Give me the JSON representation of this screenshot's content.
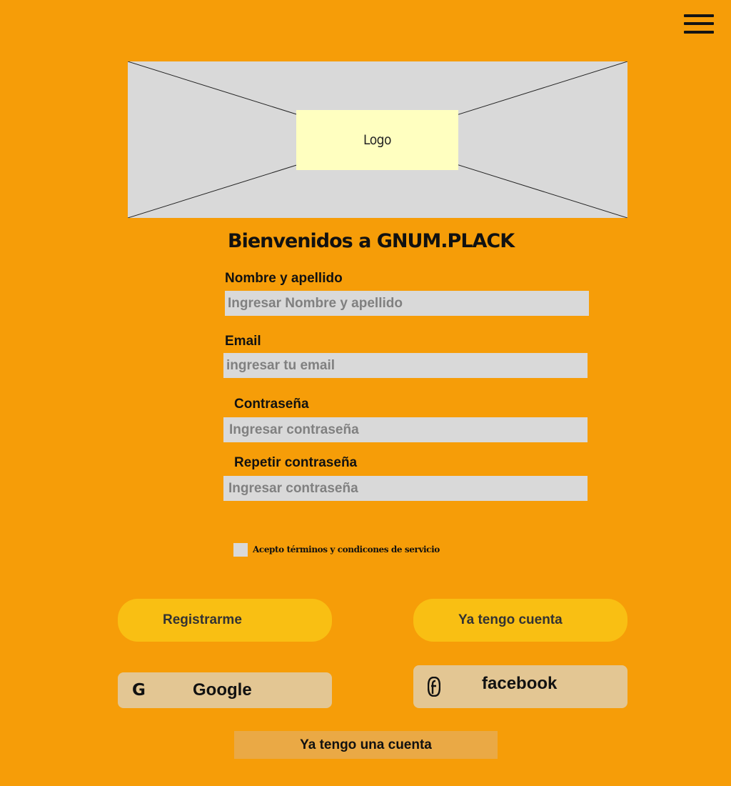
{
  "header": {
    "menu_icon": "hamburger-icon"
  },
  "hero": {
    "logo_text": "Logo"
  },
  "form": {
    "title": "Bienvenidos a GNUM.PLACK",
    "name_label": "Nombre y apellido",
    "name_placeholder": "Ingresar Nombre y apellido",
    "email_label": "Email",
    "email_placeholder": "ingresar tu email",
    "password_label": "Contraseña",
    "password_placeholder": "Ingresar contraseña",
    "repeat_password_label": "Repetir contraseña",
    "repeat_password_placeholder": "Ingresar contraseña",
    "terms_label": "Acepto términos y condicones de servicio"
  },
  "actions": {
    "register_label": "Registrarme",
    "have_account_label": "Ya tengo cuenta",
    "google_icon_glyph": "G",
    "google_label": "Google",
    "facebook_label": "facebook",
    "have_an_account_label": "Ya tengo una cuenta"
  },
  "colors": {
    "background": "#f69d08",
    "pill_button": "#f9bf13",
    "social_button": "#e3c693",
    "input_bg": "#d9d9d9",
    "logo_bg": "#ffffc0"
  }
}
